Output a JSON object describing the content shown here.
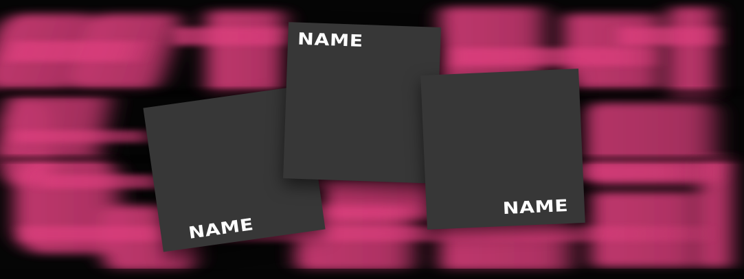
{
  "colors": {
    "background": "#050505",
    "accent_pink": "#e0407f",
    "card_fill": "#373737",
    "label_text": "#ffffff"
  },
  "cards": [
    {
      "label": "NAME"
    },
    {
      "label": "NAME"
    },
    {
      "label": "NAME"
    }
  ]
}
